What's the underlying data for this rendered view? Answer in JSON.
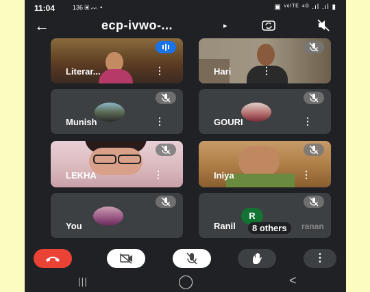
{
  "status": {
    "time": "11:04",
    "icons_left": "136 ▣ ᨓ •",
    "icons_right": "▣ ᵛᵒˡᵀᴱ ⁴ᴳ .ıl .ıl ▮"
  },
  "meeting": {
    "title": "ecp-ivwo-..."
  },
  "participants": [
    {
      "name": "Literar...",
      "type": "video",
      "mic": "active"
    },
    {
      "name": "Hari",
      "type": "video",
      "mic": "muted"
    },
    {
      "name": "Munish",
      "type": "avatar",
      "mic": "muted"
    },
    {
      "name": "GOURI",
      "type": "avatar",
      "mic": "muted"
    },
    {
      "name": "LEKHA",
      "type": "video",
      "mic": "muted"
    },
    {
      "name": "Iniya",
      "type": "video",
      "mic": "muted"
    },
    {
      "name": "You",
      "type": "avatar",
      "mic": "muted"
    },
    {
      "name": "Ranil",
      "type": "initial",
      "initial": "R",
      "others_label": "8 others",
      "overlap_text": "ranan",
      "mic": "muted"
    }
  ],
  "icons": {
    "kebab": "⋮",
    "back": "←",
    "chevron": "▸",
    "home": "◯",
    "recents": "|||",
    "nav_back": "<"
  },
  "colors": {
    "end_call": "#ea4335",
    "initial_avatar": "#137333",
    "mic_active": "#1a73e8"
  }
}
